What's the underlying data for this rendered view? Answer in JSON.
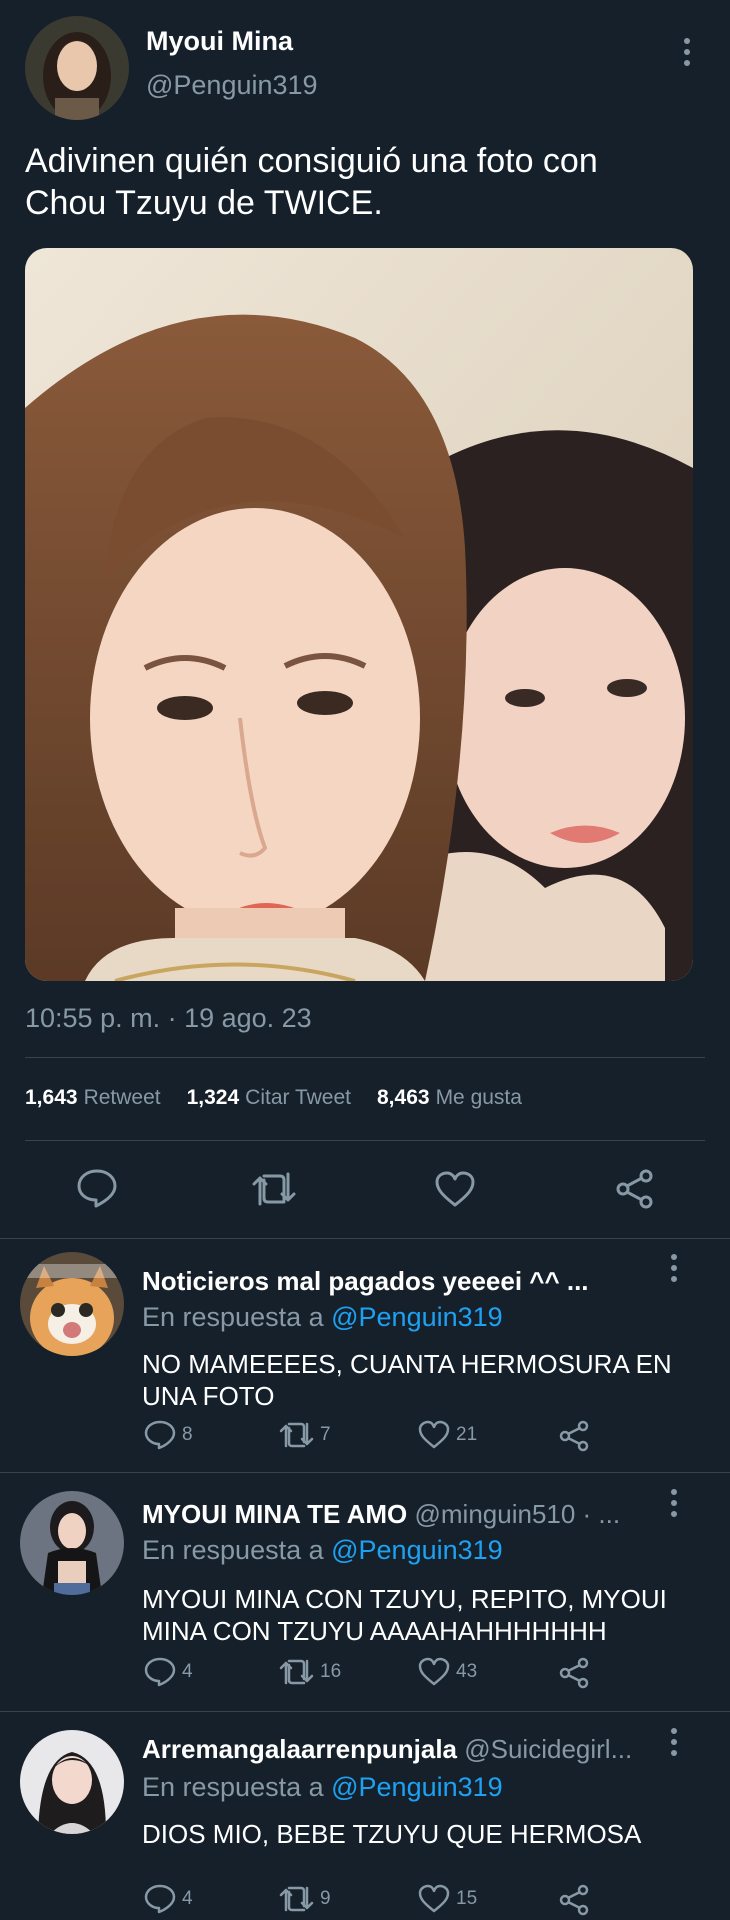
{
  "tweet": {
    "author_name": "Myoui Mina",
    "author_handle": "@Penguin319",
    "text_line1": "Adivinen quién consiguió una foto con",
    "text_line2": "Chou Tzuyu de TWICE.",
    "timestamp": "10:55 p. m. · 19 ago. 23",
    "stats": [
      {
        "count": "1,643",
        "label": "Retweet"
      },
      {
        "count": "1,324",
        "label": "Citar Tweet"
      },
      {
        "count": "8,463",
        "label": "Me gusta"
      }
    ],
    "actions": [
      "reply-icon",
      "retweet-icon",
      "heart-icon",
      "share-icon"
    ]
  },
  "replies": [
    {
      "name": "Noticieros mal pagados yeeeei ^^ ...",
      "handle": "",
      "context_prefix": "En respuesta a ",
      "context_mention": "@Penguin319",
      "text_line1": "NO MAMEEEES, CUANTA HERMOSURA EN",
      "text_line2": "UNA FOTO",
      "replies": "8",
      "retweets": "7",
      "likes": "21"
    },
    {
      "name": "MYOUI MINA TE AMO",
      "handle": " @minguin510 · ...",
      "context_prefix": "En respuesta a ",
      "context_mention": "@Penguin319",
      "text_line1": "MYOUI MINA CON TZUYU, REPITO, MYOUI",
      "text_line2": "MINA CON TZUYU AAAAHAHHHHHHH",
      "replies": "4",
      "retweets": "16",
      "likes": "43"
    },
    {
      "name": "Arremangalaarrenpunjala",
      "handle": " @Suicidegirl...",
      "context_prefix": "En respuesta a ",
      "context_mention": "@Penguin319",
      "text_line1": "DIOS MIO, BEBE TZUYU QUE HERMOSA",
      "text_line2": "",
      "replies": "4",
      "retweets": "9",
      "likes": "15"
    }
  ],
  "colors": {
    "background": "#15202b",
    "secondary_text": "#8899a6",
    "mention": "#1da1f2",
    "divider": "#38444d"
  }
}
